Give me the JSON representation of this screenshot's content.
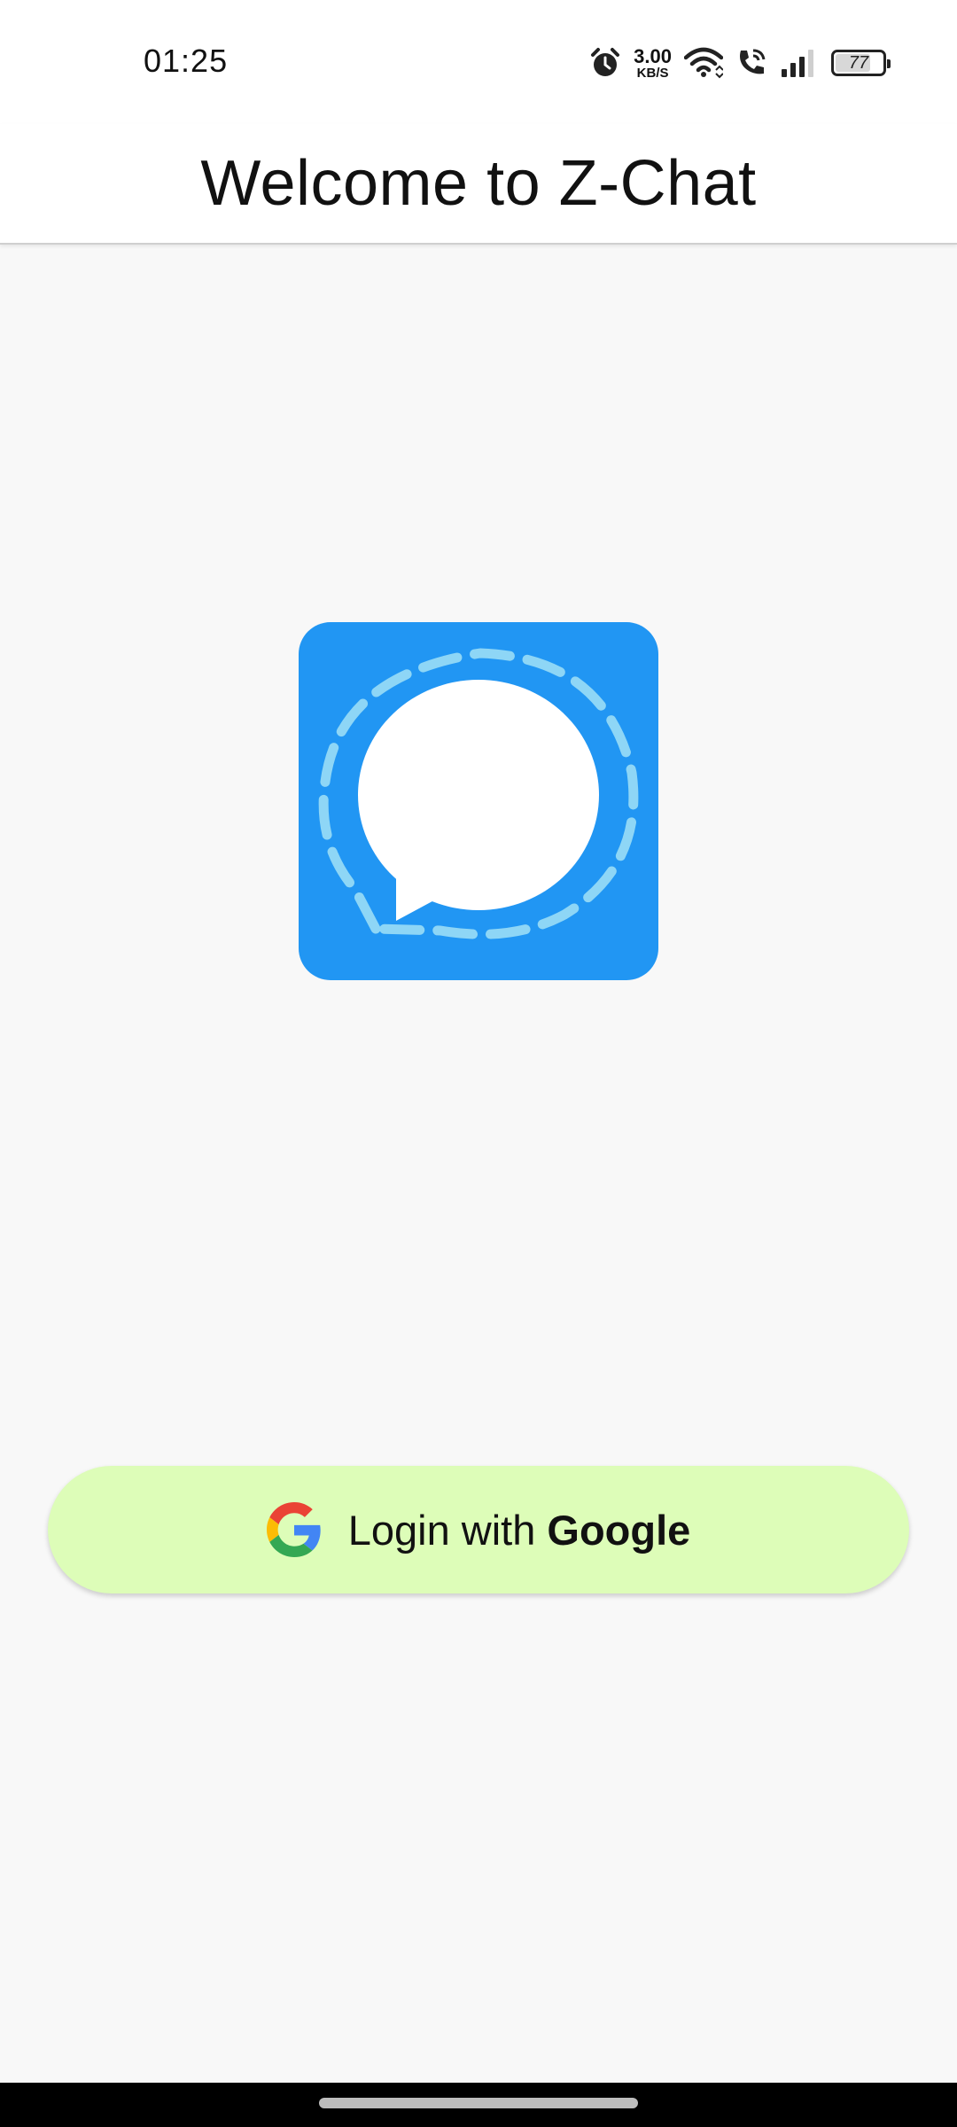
{
  "status_bar": {
    "time": "01:25",
    "net_speed_value": "3.00",
    "net_speed_unit": "KB/S",
    "battery_level": "77",
    "battery_percent": 77,
    "icons": [
      "alarm-icon",
      "wifi-icon",
      "wifi-calling-icon",
      "signal-icon",
      "battery-icon"
    ]
  },
  "app_bar": {
    "title": "Welcome to Z-Chat"
  },
  "logo": {
    "icon": "chat-bubble-logo-icon",
    "background_color": "#2196f3",
    "dash_color": "#8ed6f6"
  },
  "login": {
    "label_prefix": "Login with",
    "label_brand": "Google",
    "icon": "google-icon",
    "background_color": "#ddfdb8"
  },
  "nav_bar": {
    "indicator": "home-indicator"
  }
}
